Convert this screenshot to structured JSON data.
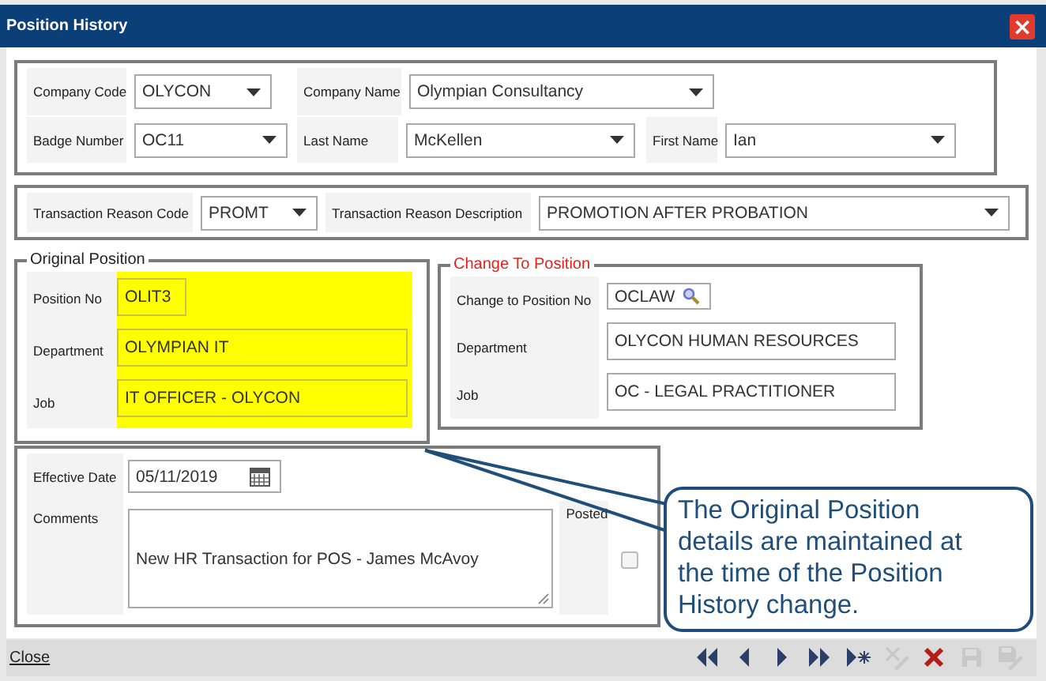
{
  "window": {
    "title": "Position History",
    "close": "×"
  },
  "header": {
    "rows": [
      [
        {
          "label": "Company Code",
          "value": "OLYCON"
        },
        {
          "label": "Company Name",
          "value": "Olympian Consultancy"
        }
      ],
      [
        {
          "label": "Badge Number",
          "value": "OC11"
        },
        {
          "label": "Last Name",
          "value": "McKellen"
        },
        {
          "label": "First Name",
          "value": "Ian"
        }
      ]
    ]
  },
  "transaction": {
    "fields": [
      {
        "label": "Transaction Reason Code",
        "value": "PROMT"
      },
      {
        "label": "Transaction Reason Description",
        "value": "PROMOTION AFTER PROBATION"
      }
    ]
  },
  "original_position": {
    "legend": "Original Position",
    "highlighted": true,
    "fields": [
      {
        "label": "Position No",
        "value": "OLIT3"
      },
      {
        "label": "Department",
        "value": "OLYMPIAN IT"
      },
      {
        "label": "Job",
        "value": "IT OFFICER - OLYCON"
      }
    ]
  },
  "change_to_position": {
    "legend": "Change To Position",
    "fields": [
      {
        "label": "Change to Position No",
        "value": "OCLAW",
        "kind": "lookup"
      },
      {
        "label": "Department",
        "value": "OLYCON HUMAN RESOURCES",
        "kind": "text"
      },
      {
        "label": "Job",
        "value": "OC - LEGAL PRACTITIONER",
        "kind": "text"
      }
    ]
  },
  "details": {
    "effective_date": {
      "label": "Effective Date",
      "value": "05/11/2019"
    },
    "comments": {
      "label": "Comments",
      "value": "New HR Transaction for POS - James  McAvoy"
    },
    "posted": {
      "label": "Posted",
      "checked": false
    }
  },
  "callout": {
    "text": "The Original Position details are maintained at the time of the Position History change."
  },
  "footer": {
    "close_link": "Close",
    "toolbar": [
      {
        "kind": "first",
        "disabled": false
      },
      {
        "kind": "previous",
        "disabled": false
      },
      {
        "kind": "next",
        "disabled": false
      },
      {
        "kind": "last",
        "disabled": false
      },
      {
        "kind": "new",
        "disabled": false
      },
      {
        "kind": "confirm",
        "disabled": true
      },
      {
        "kind": "delete",
        "disabled": false
      },
      {
        "kind": "save",
        "disabled": true
      },
      {
        "kind": "save-edit",
        "disabled": true
      }
    ]
  }
}
